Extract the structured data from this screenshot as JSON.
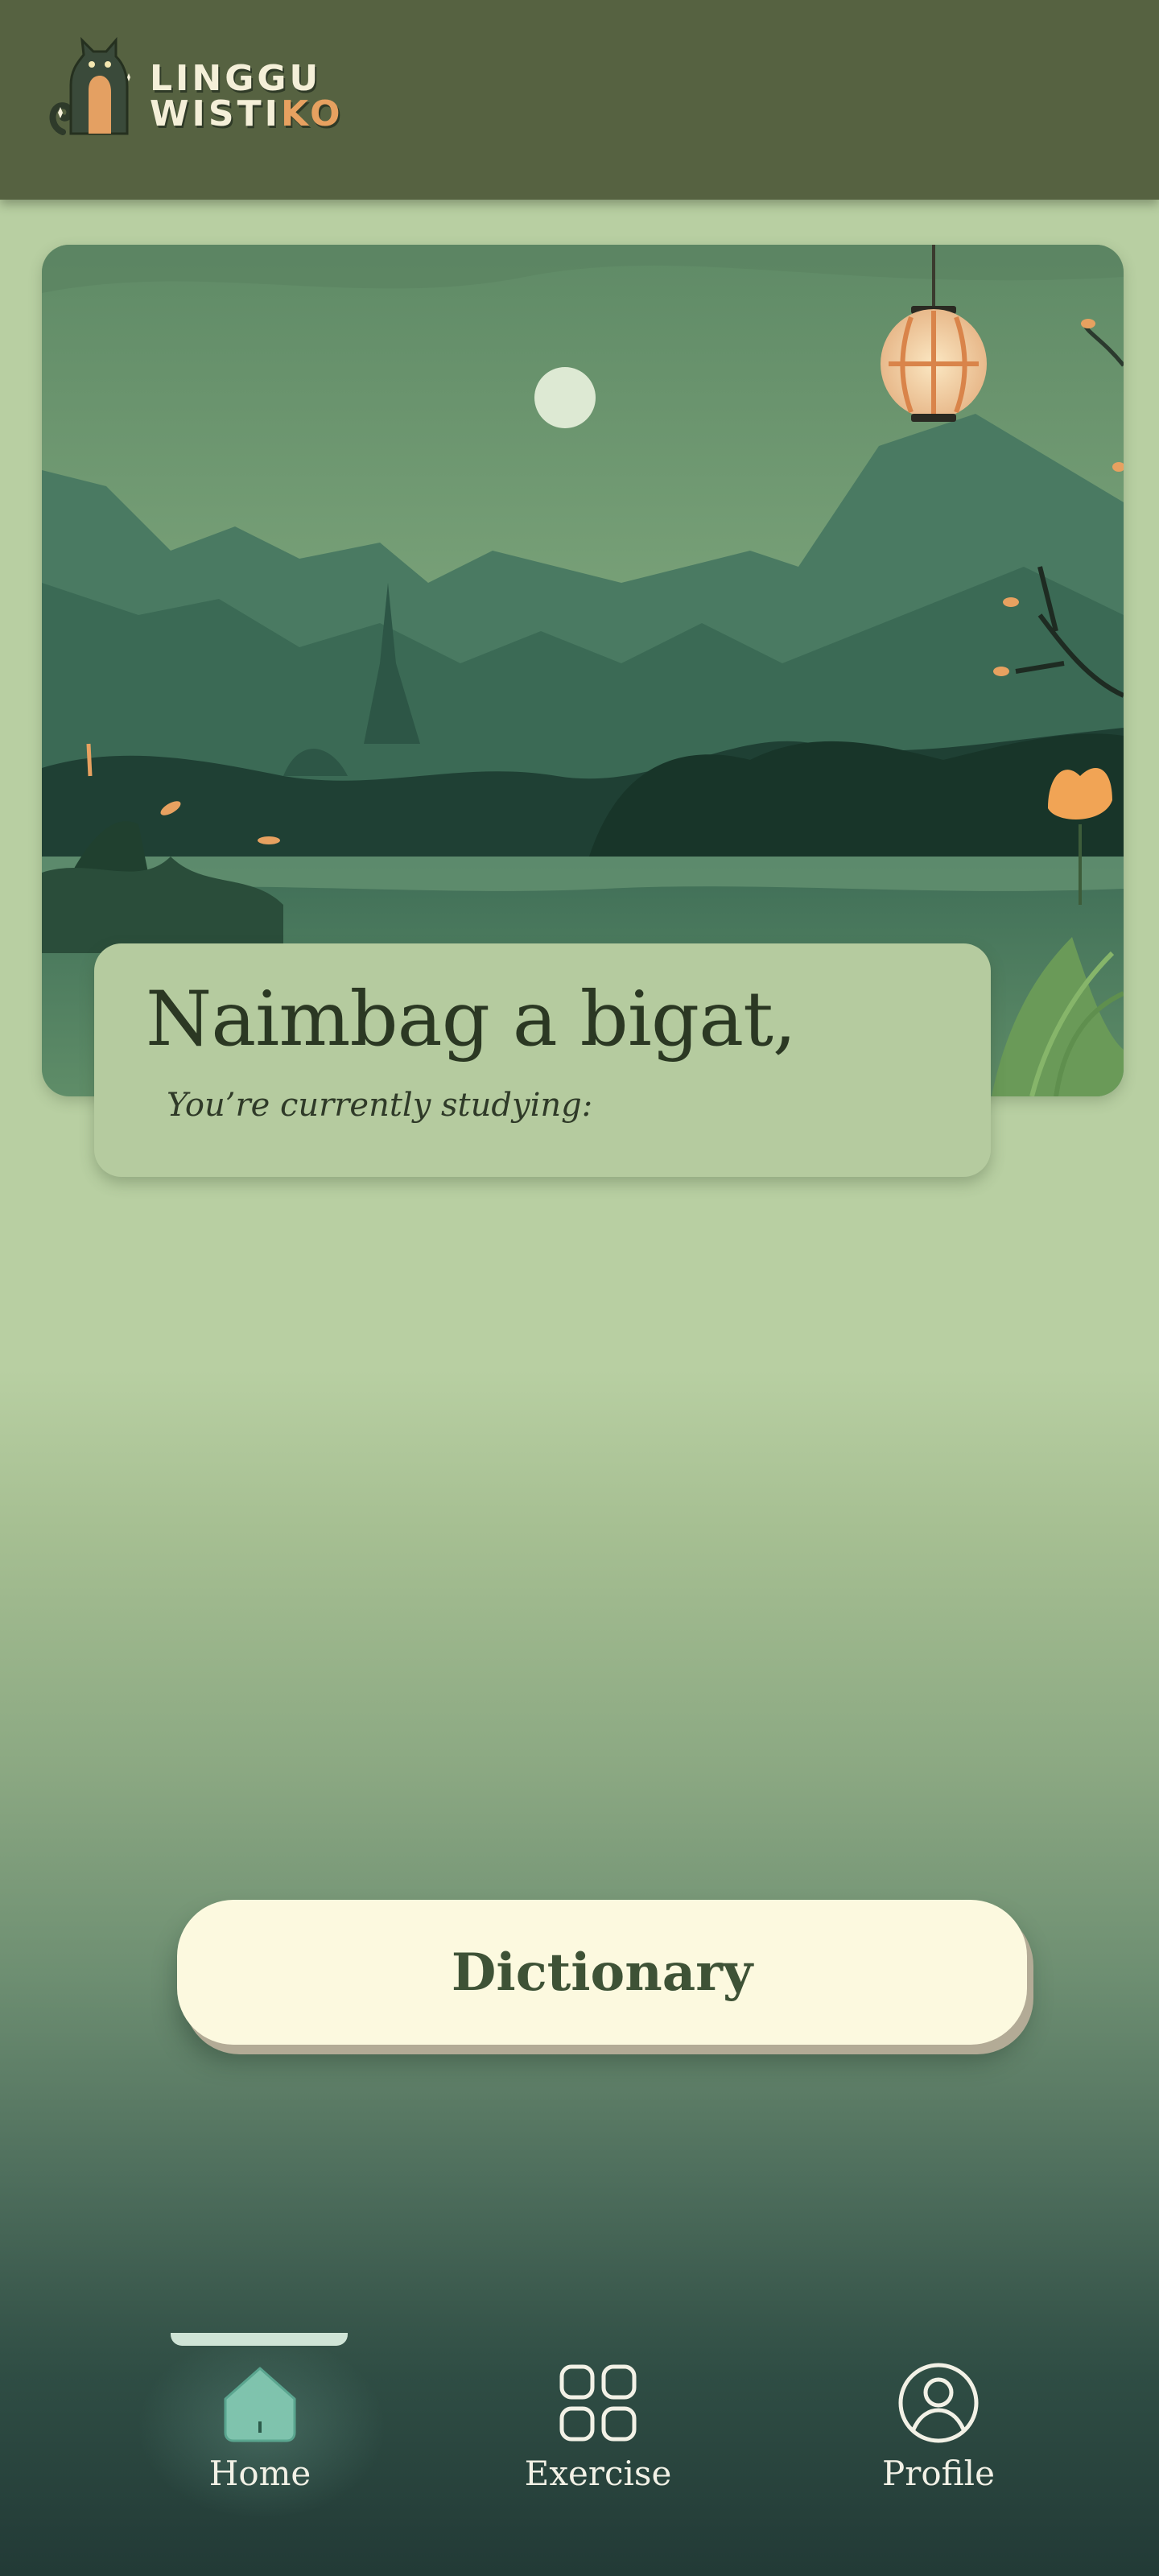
{
  "header": {
    "logo": {
      "line1": "LINGGU",
      "line2_main": "WISTI",
      "line2_accent": "KO",
      "icon": "cat-icon"
    }
  },
  "hero": {
    "icon": "landscape-illustration"
  },
  "greeting": {
    "title": "Naimbag a bigat,",
    "subtitle": "You’re currently studying:"
  },
  "dictionary": {
    "label": "Dictionary"
  },
  "nav": {
    "items": [
      {
        "label": "Home",
        "icon": "home-icon",
        "active": true
      },
      {
        "label": "Exercise",
        "icon": "grid-icon",
        "active": false
      },
      {
        "label": "Profile",
        "icon": "user-icon",
        "active": false
      }
    ]
  },
  "colors": {
    "header": "#566241",
    "background": "#b8cfa2",
    "button": "#fcf9df",
    "accent": "#e7a160",
    "nav_text": "#f2f1e6"
  }
}
